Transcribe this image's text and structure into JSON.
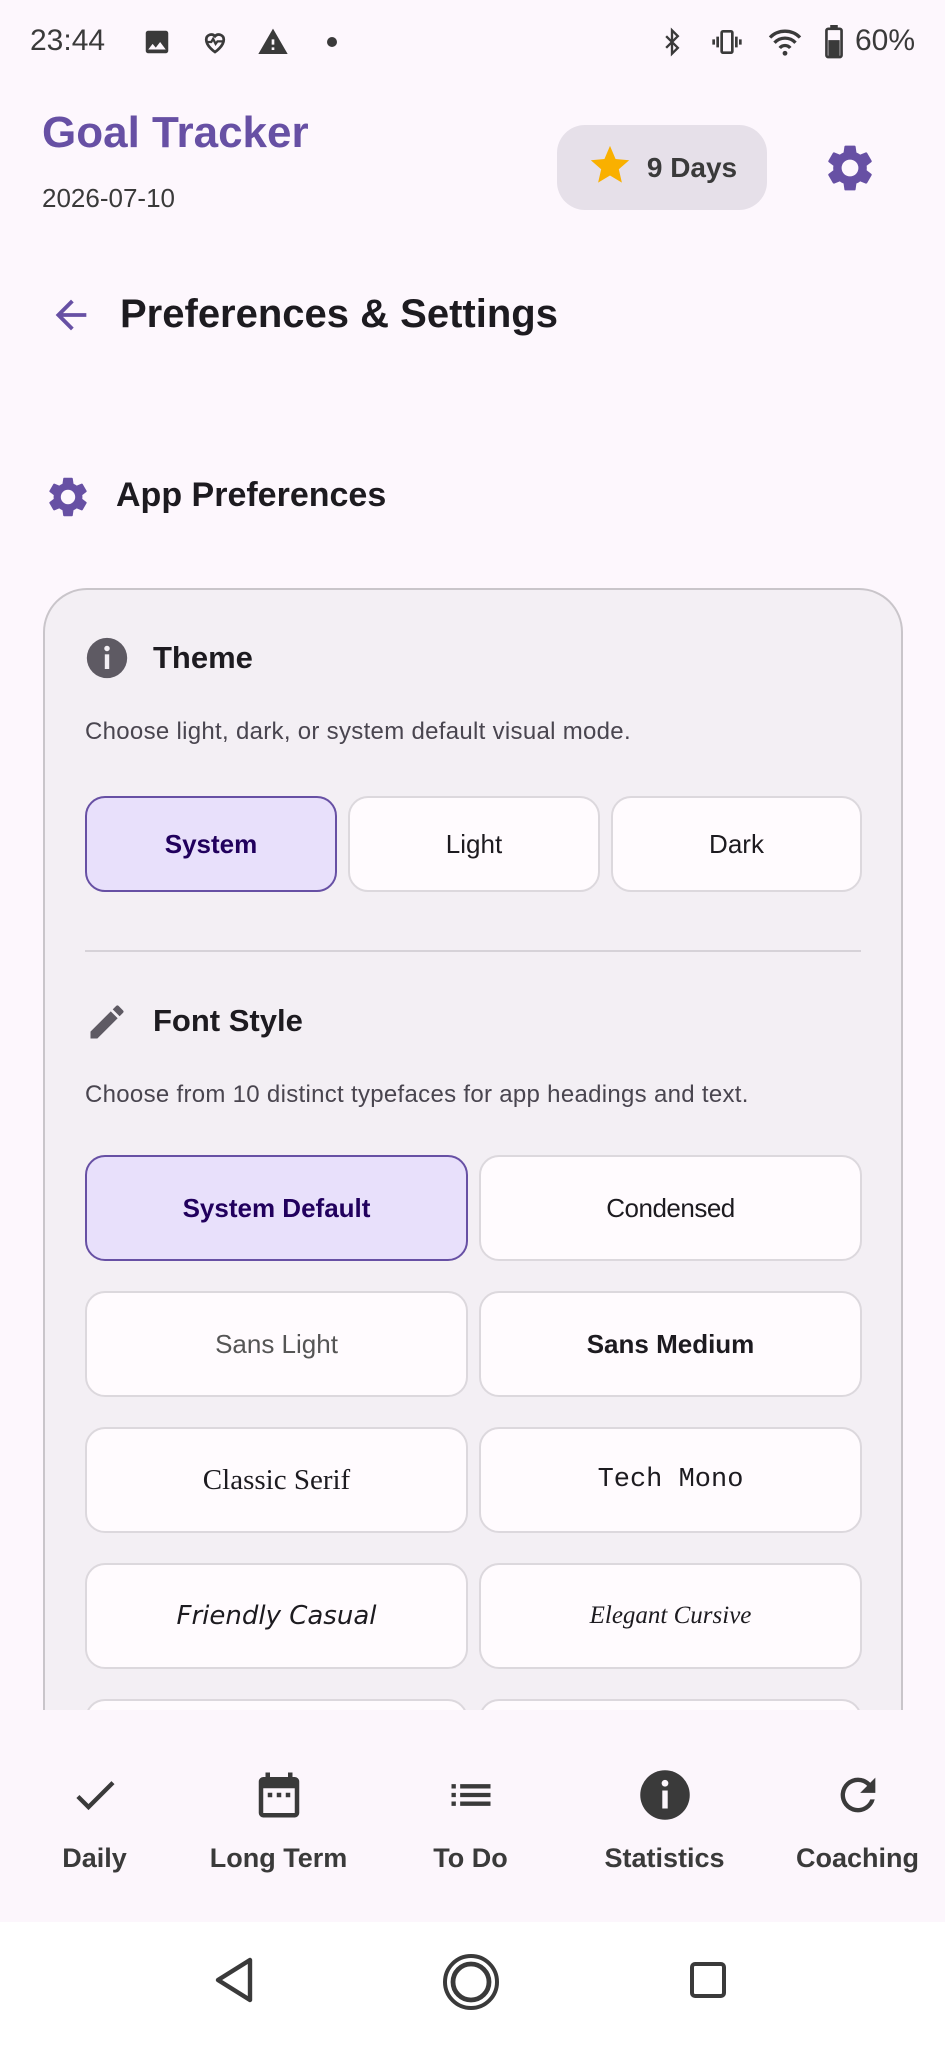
{
  "status_bar": {
    "time": "23:44",
    "battery": "60%",
    "icons": [
      "image-icon",
      "heart-icon",
      "warning-icon",
      "dot-icon",
      "bluetooth-icon",
      "vibrate-icon",
      "wifi-icon",
      "battery-icon"
    ]
  },
  "header": {
    "app_title": "Goal Tracker",
    "date": "2026-07-10",
    "streak": "9 Days"
  },
  "page": {
    "title": "Preferences & Settings",
    "section_title": "App Preferences"
  },
  "theme": {
    "title": "Theme",
    "description": "Choose light, dark, or system default visual mode.",
    "options": [
      "System",
      "Light",
      "Dark"
    ],
    "selected": "System"
  },
  "font_style": {
    "title": "Font Style",
    "description": "Choose from 10 distinct typefaces for app headings and text.",
    "options": [
      "System Default",
      "Condensed",
      "Sans Light",
      "Sans Medium",
      "Classic Serif",
      "Tech Mono",
      "Friendly Casual",
      "Elegant Cursive"
    ],
    "selected": "System Default"
  },
  "bottom_nav": {
    "items": [
      {
        "label": "Daily",
        "icon": "check-icon"
      },
      {
        "label": "Long Term",
        "icon": "calendar-icon"
      },
      {
        "label": "To Do",
        "icon": "list-icon"
      },
      {
        "label": "Statistics",
        "icon": "info-icon"
      },
      {
        "label": "Coaching",
        "icon": "refresh-icon"
      }
    ]
  },
  "colors": {
    "primary": "#6750a4",
    "background": "#fdf7fd",
    "card": "#f3eff4",
    "selected_bg": "#e8e0fb",
    "star": "#f9b000"
  }
}
